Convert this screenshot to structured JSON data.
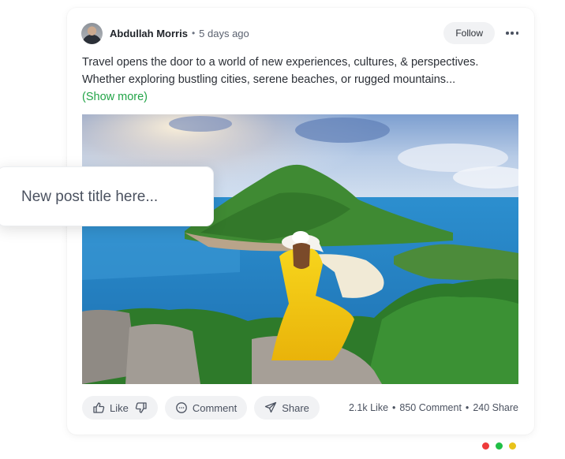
{
  "post": {
    "author": "Abdullah Morris",
    "separator": "•",
    "time": "5 days ago",
    "follow_label": "Follow",
    "more_icon": "more-horizontal-icon",
    "text": "Travel opens the door to a world of new experiences, cultures, & perspectives. Whether exploring bustling cities, serene beaches, or rugged mountains...",
    "show_more": "(Show more)"
  },
  "actions": {
    "like_label": "Like",
    "comment_label": "Comment",
    "share_label": "Share"
  },
  "stats": {
    "likes": "2.1k Like",
    "comments": "850 Comment",
    "shares": "240 Share",
    "separator": "•"
  },
  "title_input": {
    "placeholder": "New post title here..."
  },
  "status_dots": [
    "#ee3a3a",
    "#1fbf45",
    "#e8c21a"
  ]
}
